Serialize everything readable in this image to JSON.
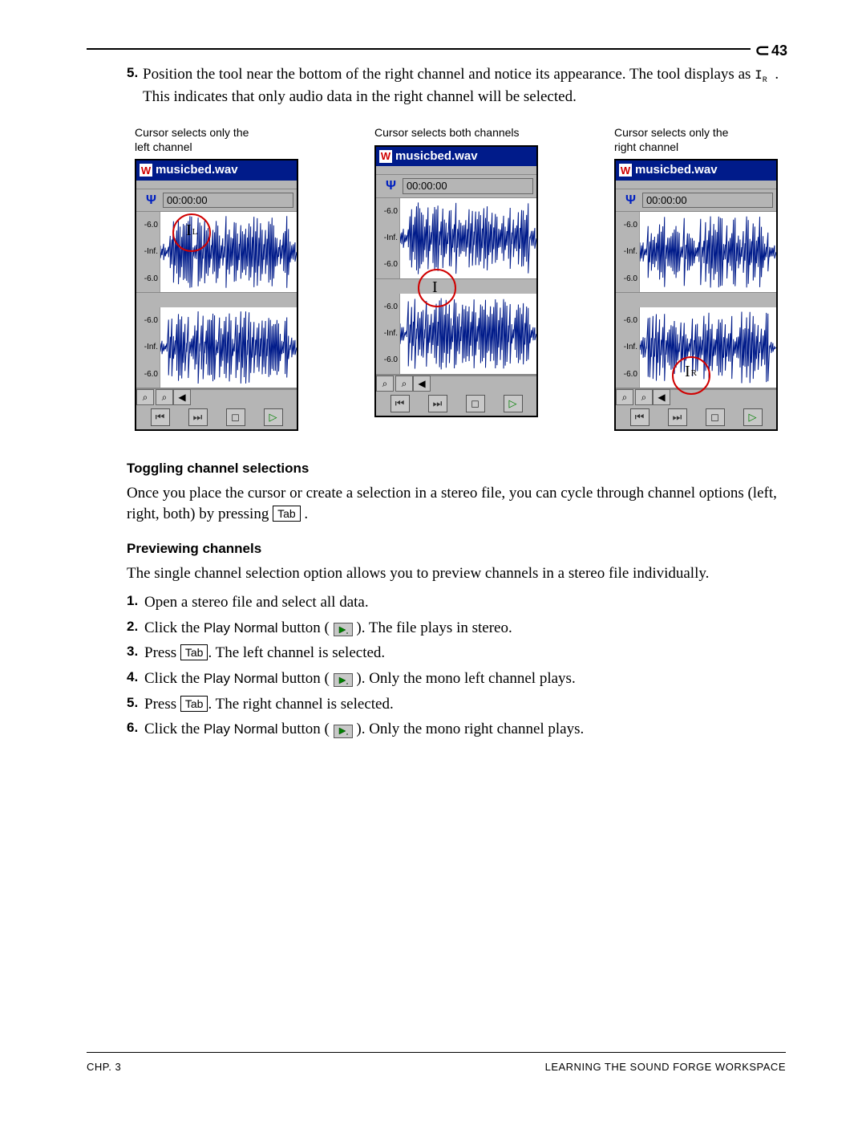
{
  "page_number": "43",
  "step5": {
    "num": "5.",
    "text_a": "Position the tool near the bottom of the right channel and notice its appearance. The tool displays as ",
    "cursor_label": "I",
    "cursor_sub": "R",
    "text_b": ". This indicates that only audio data in the right channel will be selected."
  },
  "figures": [
    {
      "caption": "Cursor selects only the left channel",
      "cursor_pos": "top",
      "cursor_sub": "L"
    },
    {
      "caption": "Cursor selects both channels",
      "cursor_pos": "mid",
      "cursor_sub": ""
    },
    {
      "caption": "Cursor selects only the right channel",
      "cursor_pos": "bot",
      "cursor_sub": "R"
    }
  ],
  "window": {
    "title": "musicbed.wav",
    "icon_letter": "W",
    "timecode": "00:00:00",
    "scale_labels": [
      "-6.0",
      "-Inf.",
      "-6.0"
    ],
    "zoom_glyphs": [
      "⌕",
      "⌕",
      "◀"
    ],
    "transport_glyphs": [
      "⏮",
      "⏭",
      "◻",
      "▷"
    ]
  },
  "toggling": {
    "heading": "Toggling channel selections",
    "text_a": "Once you place the cursor or create a selection in a stereo file, you can cycle through channel options (left, right, both) by pressing ",
    "key": "Tab",
    "text_b": "."
  },
  "preview": {
    "heading": "Previewing channels",
    "intro": "The single channel selection option allows you to preview channels in a stereo file individually.",
    "steps": [
      {
        "n": "1.",
        "parts": [
          {
            "t": "text",
            "v": "Open a stereo file and select all data."
          }
        ]
      },
      {
        "n": "2.",
        "parts": [
          {
            "t": "text",
            "v": "Click the "
          },
          {
            "t": "sans",
            "v": "Play Normal"
          },
          {
            "t": "text",
            "v": " button ("
          },
          {
            "t": "play"
          },
          {
            "t": "text",
            "v": "). The file plays in stereo."
          }
        ]
      },
      {
        "n": "3.",
        "parts": [
          {
            "t": "text",
            "v": "Press "
          },
          {
            "t": "key",
            "v": "Tab"
          },
          {
            "t": "text",
            "v": ". The left channel is selected."
          }
        ]
      },
      {
        "n": "4.",
        "parts": [
          {
            "t": "text",
            "v": "Click the "
          },
          {
            "t": "sans",
            "v": "Play Normal"
          },
          {
            "t": "text",
            "v": " button ("
          },
          {
            "t": "play"
          },
          {
            "t": "text",
            "v": "). Only the mono left channel plays."
          }
        ]
      },
      {
        "n": "5.",
        "parts": [
          {
            "t": "text",
            "v": "Press "
          },
          {
            "t": "key",
            "v": "Tab"
          },
          {
            "t": "text",
            "v": ". The right channel is selected."
          }
        ]
      },
      {
        "n": "6.",
        "parts": [
          {
            "t": "text",
            "v": "Click the "
          },
          {
            "t": "sans",
            "v": "Play Normal"
          },
          {
            "t": "text",
            "v": " button ("
          },
          {
            "t": "play"
          },
          {
            "t": "text",
            "v": "). Only the mono right channel plays."
          }
        ]
      }
    ]
  },
  "footer": {
    "left": "CHP. 3",
    "right": "LEARNING THE SOUND FORGE WORKSPACE"
  }
}
